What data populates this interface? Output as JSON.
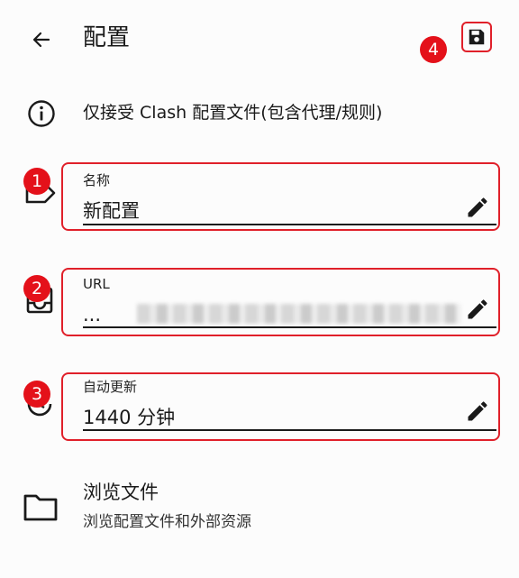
{
  "header": {
    "title": "配置"
  },
  "info": {
    "text": "仅接受 Clash 配置文件(包含代理/规则)"
  },
  "fields": {
    "name": {
      "label": "名称",
      "value": "新配置"
    },
    "url": {
      "label": "URL",
      "value": "..."
    },
    "auto_update": {
      "label": "自动更新",
      "value": "1440 分钟"
    }
  },
  "browse": {
    "title": "浏览文件",
    "subtitle": "浏览配置文件和外部资源"
  },
  "markers": {
    "m1": "1",
    "m2": "2",
    "m3": "3",
    "m4": "4"
  },
  "colors": {
    "annotation_red": "#e0202a",
    "text": "#1a1a1a",
    "background": "#fcfcfc"
  },
  "icons": {
    "back": "arrow-left-icon",
    "save": "floppy-disk-icon",
    "info": "info-circle-icon",
    "name": "label-tag-icon",
    "url": "inbox-tray-icon",
    "auto_update": "refresh-clock-icon",
    "edit": "pencil-icon",
    "browse": "folder-icon"
  }
}
